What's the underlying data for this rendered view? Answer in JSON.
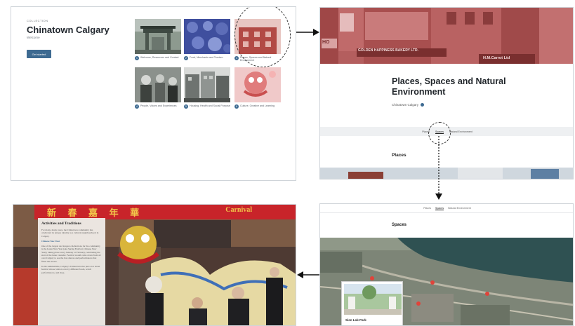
{
  "panel_collection": {
    "kicker": "COLLECTION",
    "title": "Chinatown Calgary",
    "subtitle": "Welcome",
    "button_label": "Get started",
    "cards": [
      {
        "num": "1",
        "label": "Welcome, Resources and Contact"
      },
      {
        "num": "2",
        "label": "Food, Merchants and Tourism"
      },
      {
        "num": "3",
        "label": "Places, Spaces and Natural Environment"
      },
      {
        "num": "4",
        "label": "People, Voices and Experiences"
      },
      {
        "num": "5",
        "label": "Housing, Health and Social Purpose"
      },
      {
        "num": "6",
        "label": "Culture, Creative and Learning"
      }
    ]
  },
  "panel_story": {
    "title": "Places, Spaces and Natural Environment",
    "byline": "Chinatown Calgary",
    "nav": [
      "Places",
      "Spaces",
      "Natural Environment"
    ],
    "nav_active": "Spaces",
    "section": "Places",
    "hero_signs": [
      "GOLDEN HAPPINESS BAKERY LTD.",
      "H.M.Carrot Ltd",
      "HO"
    ]
  },
  "panel_spaces": {
    "nav": [
      "Places",
      "Spaces",
      "Natural Environment"
    ],
    "nav_active": "Spaces",
    "heading": "Spaces",
    "popup_name": "Sien Lok Park"
  },
  "panel_activities": {
    "title": "Activities and Traditions",
    "intro": "For many, many years, the Chinatown community has celebrated its unique identity as a cultural neighbourhood in Calgary.",
    "subheading": "Chinese New Year",
    "para2": "One of the largest and longest celebrations for the community is the Lunar New Year (aka Spring Festival, Chinese New Year), taking place every January or February, celebrating the start of the lunar calendar. Festival would come down from all over Calgary to see the lion dances and performances that filled the streets.",
    "para3": "In the summertime, Calgary's Chinatown also puts on a street festival whose visitors can try different foods, watch performances, and shop.",
    "banner_chars": "新 春 嘉 年 華",
    "banner_text": "Carnival"
  },
  "colors": {
    "accent": "#3d6a91",
    "hero_red": "#b55a5a",
    "banner_red": "#c8242a"
  }
}
